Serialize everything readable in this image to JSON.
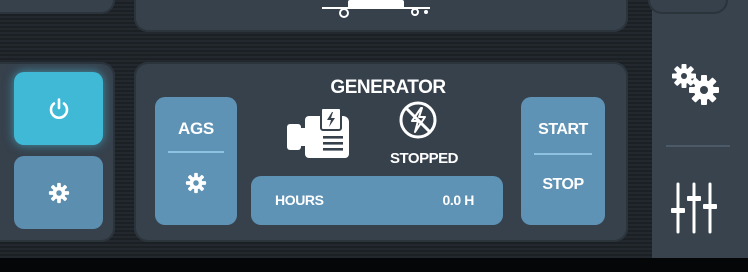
{
  "generator": {
    "title": "GENERATOR",
    "status": "STOPPED",
    "hours_label": "HOURS",
    "hours_value": "0.0 H"
  },
  "controls": {
    "ags_label": "AGS",
    "start_label": "START",
    "stop_label": "STOP"
  },
  "icons": {
    "power": "power-icon",
    "settings": "gear-icon",
    "generator": "generator-icon",
    "status": "no-power-icon",
    "sidebar_settings": "gears-icon",
    "sidebar_adjust": "sliders-icon"
  },
  "colors": {
    "accent_active": "#3fb9d6",
    "button": "#5f93b5",
    "panel": "#36414c",
    "background": "#1d2227"
  }
}
